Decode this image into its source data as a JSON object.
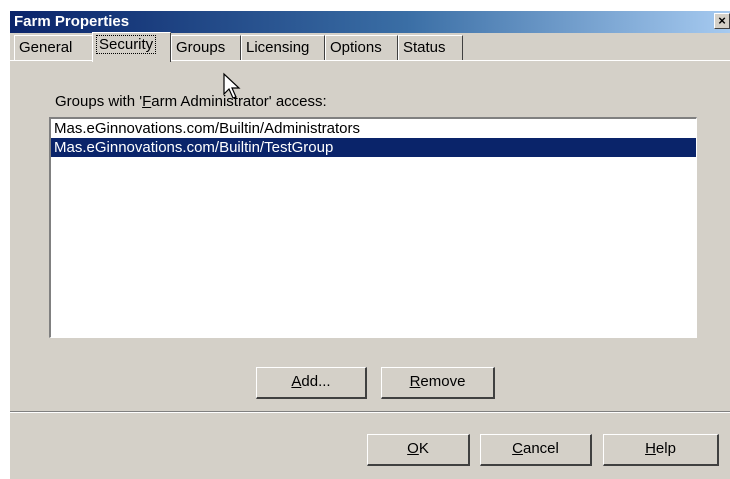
{
  "window": {
    "title": "Farm Properties",
    "close_label": "×"
  },
  "tabs": [
    {
      "label": "General"
    },
    {
      "label": "Security",
      "active": true
    },
    {
      "label": "Groups"
    },
    {
      "label": "Licensing"
    },
    {
      "label": "Options"
    },
    {
      "label": "Status"
    }
  ],
  "security": {
    "groups_label": {
      "prefix": "Groups with '",
      "accel": "F",
      "suffix": "arm Administrator' access:"
    },
    "groups": [
      {
        "text": "Mas.eGinnovations.com/Builtin/Administrators",
        "selected": false
      },
      {
        "text": "Mas.eGinnovations.com/Builtin/TestGroup",
        "selected": true
      }
    ],
    "add_button": {
      "accel": "A",
      "rest": "dd..."
    },
    "remove_button": {
      "accel": "R",
      "rest": "emove"
    }
  },
  "footer": {
    "ok_button": {
      "accel": "O",
      "rest": "K"
    },
    "cancel_button": {
      "accel": "C",
      "rest": "ancel"
    },
    "help_button": {
      "accel": "H",
      "rest": "elp"
    }
  },
  "colors": {
    "dialog_bg": "#d4d0c8",
    "title_bar": "#0a246a",
    "selection": "#0a246a"
  }
}
